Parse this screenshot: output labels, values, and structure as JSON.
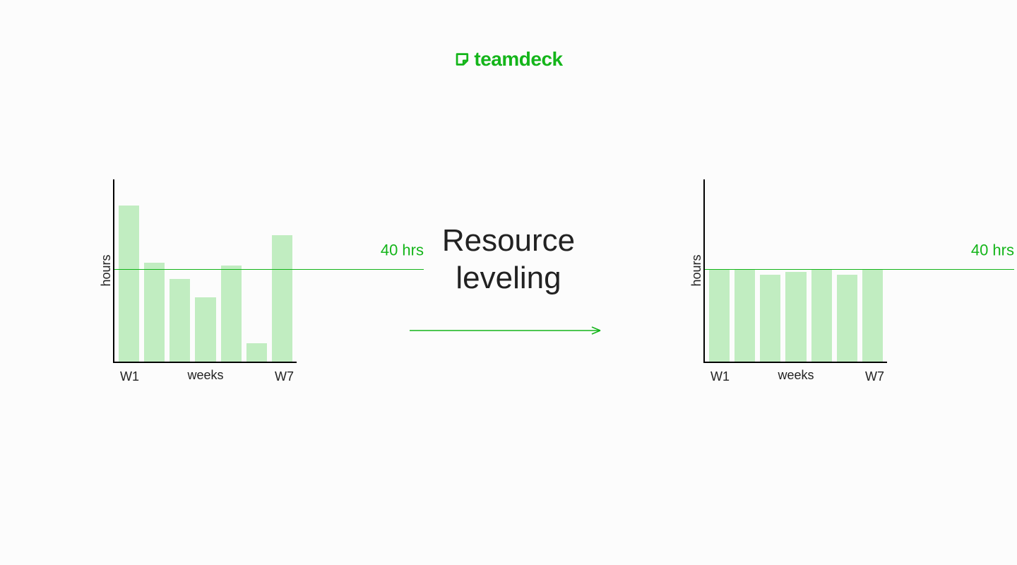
{
  "brand": {
    "name": "teamdeck"
  },
  "center_title_line1": "Resource",
  "center_title_line2": "leveling",
  "colors": {
    "brand": "#14b51a",
    "bar": "#c1edc1"
  },
  "chart_data": [
    {
      "type": "bar",
      "id": "before",
      "categories": [
        "W1",
        "W2",
        "W3",
        "W4",
        "W5",
        "W6",
        "W7"
      ],
      "values": [
        68,
        43,
        36,
        28,
        42,
        8,
        55
      ],
      "reference": 40,
      "reference_label": "40 hrs",
      "xlabel": "weeks",
      "ylabel": "hours",
      "ylim": [
        0,
        80
      ],
      "tick_first": "W1",
      "tick_last": "W7"
    },
    {
      "type": "bar",
      "id": "after",
      "categories": [
        "W1",
        "W2",
        "W3",
        "W4",
        "W5",
        "W6",
        "W7"
      ],
      "values": [
        40,
        40,
        38,
        39,
        40,
        38,
        40
      ],
      "reference": 40,
      "reference_label": "40 hrs",
      "xlabel": "weeks",
      "ylabel": "hours",
      "ylim": [
        0,
        80
      ],
      "tick_first": "W1",
      "tick_last": "W7"
    }
  ]
}
